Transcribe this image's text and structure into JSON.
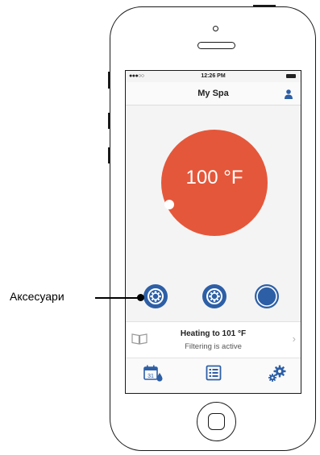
{
  "status_bar": {
    "signal": "●●●○○",
    "time": "12:26 PM"
  },
  "header": {
    "title": "My Spa"
  },
  "temperature": {
    "display": "100 °F"
  },
  "accessories": [
    {
      "name": "accessory-1",
      "color": "#2d5fa6",
      "state": "on"
    },
    {
      "name": "accessory-2",
      "color": "#2d5fa6",
      "state": "on"
    },
    {
      "name": "accessory-3",
      "color": "#2d5fa6",
      "state": "off"
    }
  ],
  "status_panel": {
    "heating": "Heating to 101 °F",
    "filtering": "Filtering is active"
  },
  "tab_bar": {
    "calendar_day": "31",
    "icons": [
      "calendar-icon",
      "list-icon",
      "settings-gears-icon"
    ]
  },
  "callout": {
    "label": "Аксесуари"
  },
  "colors": {
    "accent_orange": "#e5573a",
    "accent_blue": "#2d5fa6"
  }
}
